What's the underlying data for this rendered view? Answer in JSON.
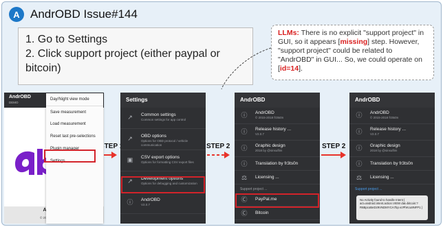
{
  "header": {
    "badge": "A",
    "title": "AndrOBD Issue#144"
  },
  "instructions": {
    "line1": "1. Go to Settings",
    "line2": "2. Click support project (either paypal or bitcoin)"
  },
  "note": {
    "lead": "LLMs:",
    "t1": " There is no explicit \"support project\" in GUI, so it appears [",
    "missing": "missing",
    "t2": "] step. However, \"support project\" could be related to \"AndrOBD\" in GUI... So, we could operate on [",
    "id": "id=14",
    "t3": "]."
  },
  "steps": {
    "s1": "STEP 1",
    "s2": "STEP 2",
    "s3": "STEP 2"
  },
  "screen1": {
    "app_title": "AndrOBD",
    "app_sub": "DEMO",
    "menu": [
      "Day/Night view mode",
      "Save measurement",
      "Load measurement",
      "Reset last pre-selections",
      "Plugin manager",
      "Settings"
    ],
    "footer_title": "AndrOBD",
    "footer_version": "V2.0.7",
    "footer_copy": "© 2015-2018 fr3ts0n"
  },
  "screen2": {
    "header": "Settings",
    "items": [
      {
        "title": "Common settings",
        "sub": "Common settings for app control",
        "icon": "wrench-icon"
      },
      {
        "title": "OBD options",
        "sub": "Options for OBD protocol / vehicle communication",
        "icon": "wrench-icon"
      },
      {
        "title": "CSV export options",
        "sub": "Options for formatting CSV export files",
        "icon": "save-icon"
      },
      {
        "title": "Development options",
        "sub": "Options for debugging and customization",
        "icon": "wrench-icon"
      },
      {
        "title": "AndrOBD",
        "sub": "V2.0.7",
        "icon": "info-icon"
      }
    ]
  },
  "screen3": {
    "header": "AndrOBD",
    "items": [
      {
        "title": "AndrOBD",
        "sub": "© 2015-2018 fr3ts0n",
        "icon": "info-icon"
      },
      {
        "title": "Release history ...",
        "sub": "V2.0.7",
        "icon": "info-icon"
      },
      {
        "title": "Graphic design",
        "sub": "2018 by @sinsuflim",
        "icon": "info-icon"
      },
      {
        "title": "Translation by fr3ts0n",
        "sub": "",
        "icon": "info-icon"
      },
      {
        "title": "Licensing ...",
        "sub": "",
        "icon": "license-icon"
      }
    ],
    "section": "Support project ...",
    "support": [
      {
        "title": "PayPal.me",
        "icon": "dollar-icon"
      },
      {
        "title": "Bitcoin",
        "icon": "dollar-icon"
      }
    ]
  },
  "screen4": {
    "header": "AndrOBD",
    "items": [
      {
        "title": "AndrOBD",
        "sub": "© 2015-2018 fr3ts0n",
        "icon": "info-icon"
      },
      {
        "title": "Release history ...",
        "sub": "V2.0.7",
        "icon": "info-icon"
      },
      {
        "title": "Graphic design",
        "sub": "2018 by @sinsuflim",
        "icon": "info-icon"
      },
      {
        "title": "Translation by fr3ts0n",
        "sub": "",
        "icon": "info-icon"
      },
      {
        "title": "Licensing ...",
        "sub": "",
        "icon": "license-icon"
      }
    ],
    "section": "Support project ...",
    "toast": "No Activity found to handle Intent { act=android.intent.action.VIEW dat=bitcoin:?R6BpcoBeDz9VNDMYCA7bp ezPhKcu9NFP1 }"
  },
  "colors": {
    "accent_blue": "#1d78c8",
    "highlight_red": "#d3232a",
    "arrow_red": "#e8332a",
    "phone_dark": "#2f3033",
    "support_blue": "#4a9ff0"
  }
}
